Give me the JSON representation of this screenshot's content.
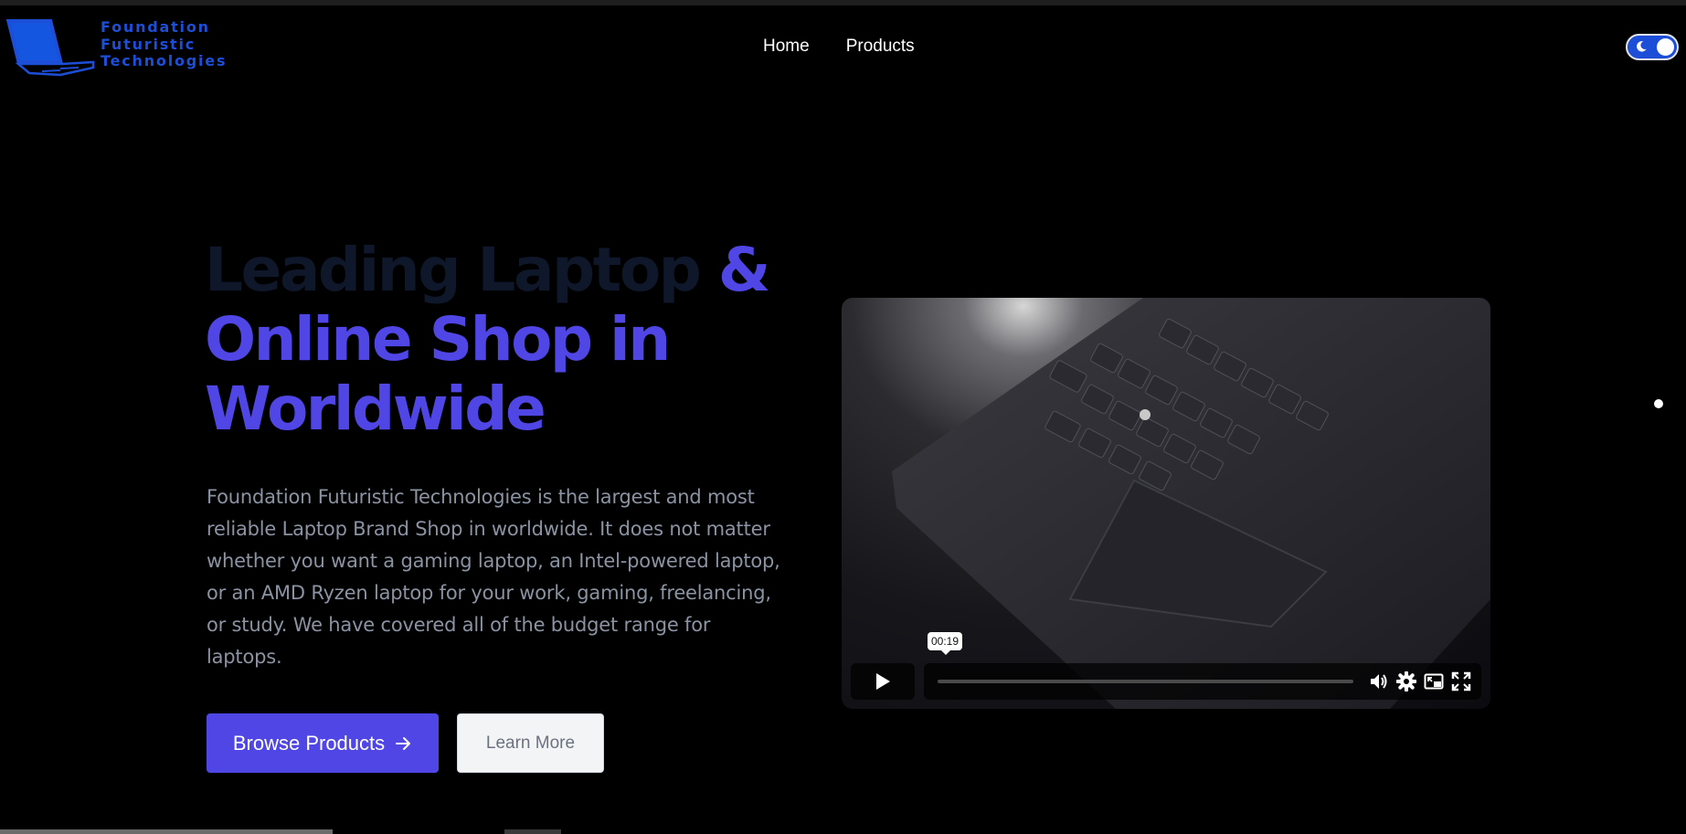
{
  "brand": {
    "line1": "Foundation",
    "line2": "Futuristic",
    "line3": "Technologies",
    "logo_icon": "laptop-icon",
    "color": "#1d4ed8"
  },
  "nav": {
    "items": [
      {
        "label": "Home"
      },
      {
        "label": "Products"
      }
    ]
  },
  "theme_toggle": {
    "icon": "moon-icon",
    "state": "dark"
  },
  "hero": {
    "title_part1": "Leading Laptop ",
    "title_part2": "& Online Shop in Worldwide",
    "description": "Foundation Futuristic Technologies is the largest and most reliable Laptop Brand Shop in worldwide. It does not matter whether you want a gaming laptop, an Intel-powered laptop, or an AMD Ryzen laptop for your work, gaming, freelancing, or study. We have covered all of the budget range for laptops.",
    "primary_button": "Browse Products",
    "secondary_button": "Learn More",
    "accent_color": "#4f46e5"
  },
  "video": {
    "time": "00:19",
    "progress": 0.0,
    "icons": [
      "play-icon",
      "volume-icon",
      "settings-icon",
      "pip-icon",
      "fullscreen-icon"
    ]
  }
}
